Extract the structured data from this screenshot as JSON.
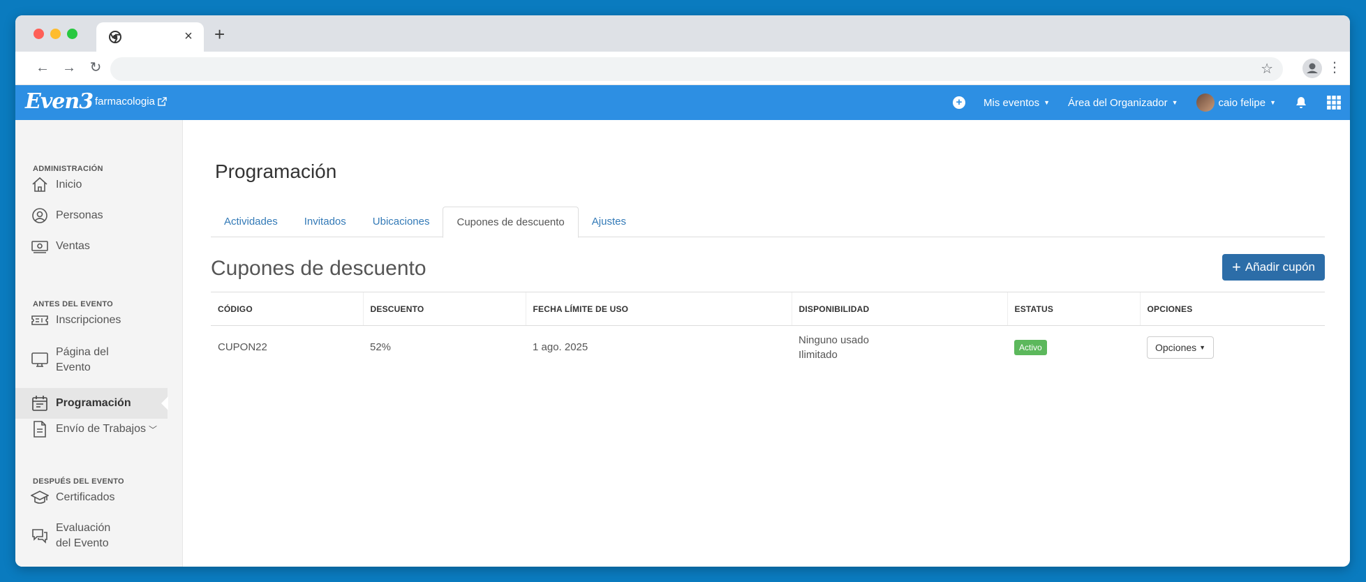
{
  "browser": {
    "tab_close": "×",
    "new_tab": "+"
  },
  "header": {
    "logo": "Even3",
    "event_name": "farmacologia",
    "menu": [
      {
        "label": "Mis eventos"
      },
      {
        "label": "Área del Organizador"
      },
      {
        "label": "caio felipe"
      }
    ]
  },
  "sidebar": {
    "sections": [
      {
        "title": "ADMINISTRACIÓN"
      },
      {
        "title": "ANTES DEL EVENTO"
      },
      {
        "title": "DESPUÉS DEL EVENTO"
      }
    ],
    "items": [
      {
        "label": "Inicio",
        "icon": "home-icon"
      },
      {
        "label": "Personas",
        "icon": "user-circle-icon"
      },
      {
        "label": "Ventas",
        "icon": "money-icon"
      },
      {
        "label": "Inscripciones",
        "icon": "ticket-icon"
      },
      {
        "label": "Página del",
        "label2": "Evento",
        "icon": "monitor-icon"
      },
      {
        "label": "Programación",
        "icon": "calendar-icon"
      },
      {
        "label": "Envío de Trabajos",
        "icon": "document-icon"
      },
      {
        "label": "Certificados",
        "icon": "graduation-cap-icon"
      },
      {
        "label": "Evaluación",
        "label2": "del Evento",
        "icon": "chat-icon"
      }
    ]
  },
  "main": {
    "page_title": "Programación",
    "tabs": [
      {
        "label": "Actividades"
      },
      {
        "label": "Invitados"
      },
      {
        "label": "Ubicaciones"
      },
      {
        "label": "Cupones de descuento"
      },
      {
        "label": "Ajustes"
      }
    ],
    "subtitle": "Cupones de descuento",
    "add_button": "Añadir cupón",
    "table": {
      "headers": [
        "CÓDIGO",
        "DESCUENTO",
        "FECHA LÍMITE DE USO",
        "DISPONIBILIDAD",
        "ESTATUS",
        "OPCIONES"
      ],
      "rows": [
        {
          "code": "CUPON22",
          "discount": "52%",
          "deadline": "1 ago. 2025",
          "availability_used": "Ninguno usado",
          "availability_limit": "Ilimitado",
          "status": "Activo",
          "options": "Opciones"
        }
      ]
    }
  },
  "colors": {
    "header_blue": "#2d8fe3",
    "button_blue": "#2c6da8",
    "status_green": "#5cb85c",
    "link_blue": "#337ab7"
  }
}
